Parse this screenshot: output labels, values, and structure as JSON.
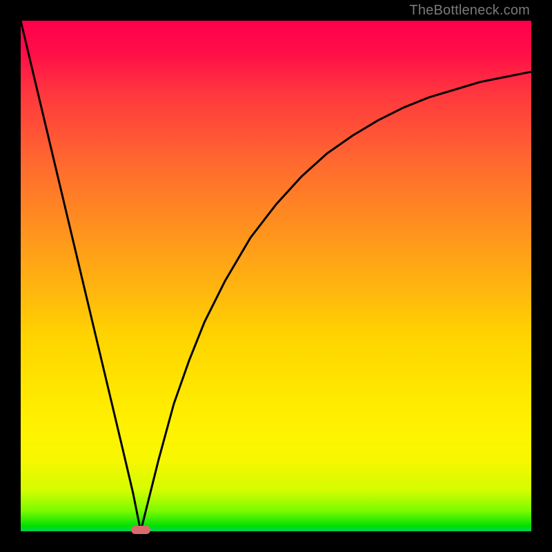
{
  "watermark": "TheBottleneck.com",
  "marker": {
    "x_pct": 23.5,
    "y_pct": 99.7
  },
  "chart_data": {
    "type": "line",
    "title": "",
    "xlabel": "",
    "ylabel": "",
    "xlim": [
      0,
      100
    ],
    "ylim": [
      0,
      100
    ],
    "grid": false,
    "legend": false,
    "series": [
      {
        "name": "curve",
        "x": [
          0,
          5,
          10,
          15,
          20,
          22,
          23.5,
          25,
          27,
          30,
          33,
          36,
          40,
          45,
          50,
          55,
          60,
          65,
          70,
          75,
          80,
          85,
          90,
          95,
          100
        ],
        "y": [
          100,
          79,
          58,
          37,
          16,
          7.5,
          0,
          6,
          14,
          25,
          33.5,
          41,
          49,
          57.5,
          64,
          69.5,
          74,
          77.5,
          80.5,
          83,
          85,
          86.5,
          88,
          89,
          90
        ]
      }
    ],
    "background_gradient_stops": [
      {
        "pct": 0,
        "color": "#ff004a"
      },
      {
        "pct": 50,
        "color": "#ffb000"
      },
      {
        "pct": 80,
        "color": "#fff200"
      },
      {
        "pct": 100,
        "color": "#00cf5b"
      }
    ]
  }
}
